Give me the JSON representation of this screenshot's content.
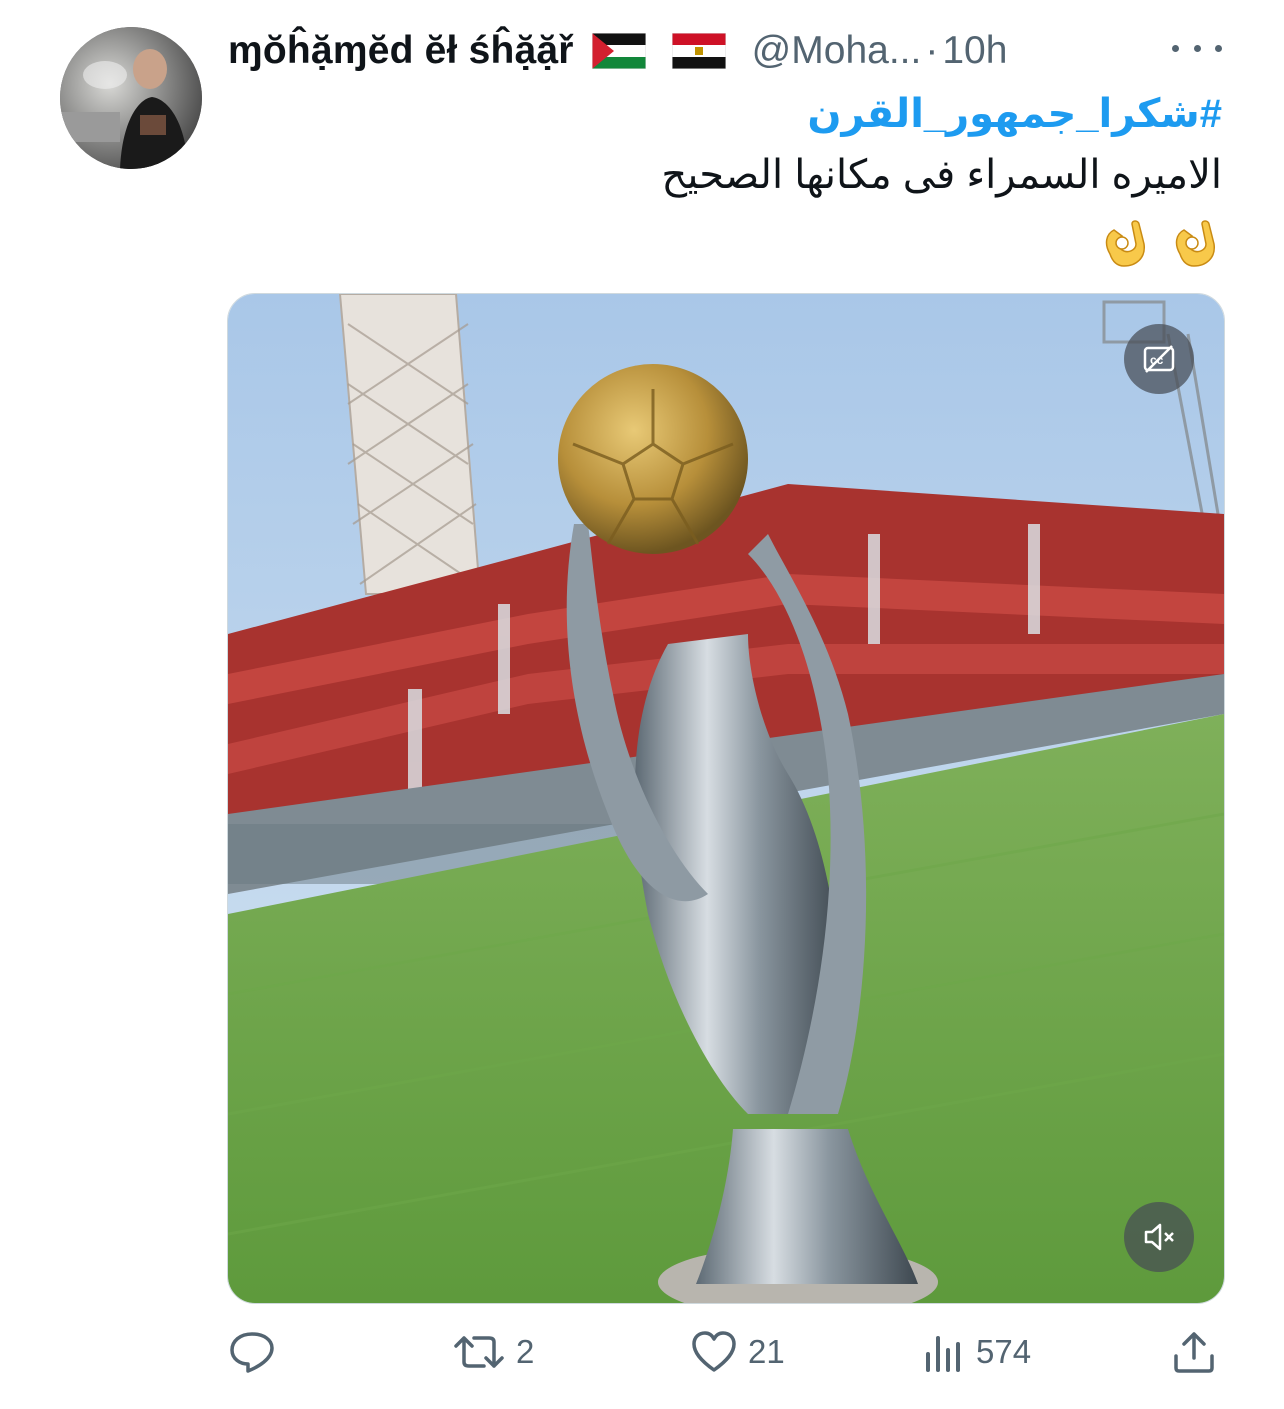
{
  "tweet": {
    "display_name": "ɱŏĥặɱĕd ĕł śĥặặř",
    "flags": [
      "palestine-flag-icon",
      "egypt-flag-icon"
    ],
    "handle": "@Moha...",
    "separator": "·",
    "time": "10h",
    "hashtag": "#شكرا_جمهور_القرن",
    "body": "الاميره السمراء فى مكانها الصحيح",
    "emojis": [
      "ok-hand-icon",
      "ok-hand-icon"
    ]
  },
  "media": {
    "type": "video",
    "description_icons": [
      "captions-off-icon",
      "muted-speaker-icon"
    ]
  },
  "actions": {
    "reply_count": "",
    "retweet_count": "2",
    "like_count": "21",
    "views_count": "574"
  },
  "colors": {
    "accent": "#1d9bf0",
    "secondary_text": "#536471",
    "primary_text": "#0f1419"
  }
}
